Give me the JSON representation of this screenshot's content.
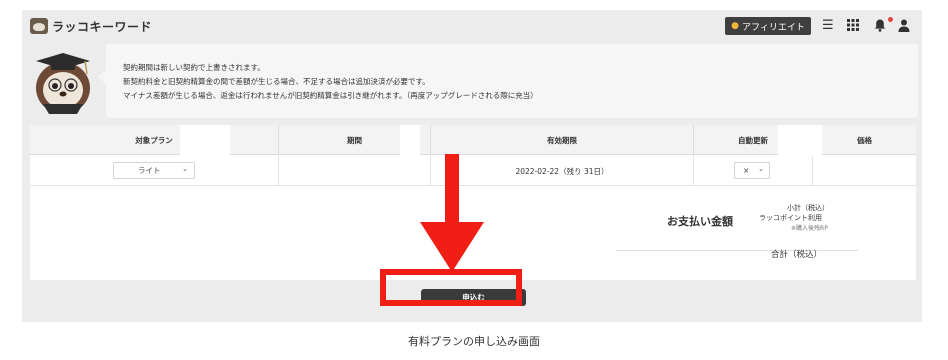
{
  "header": {
    "app_name": "ラッコキーワード",
    "affiliate_label": "アフィリエイト",
    "icons": [
      "coin-icon",
      "menu-icon",
      "grid-icon",
      "bell-icon",
      "user-icon"
    ]
  },
  "notice": {
    "lines": [
      "契約期間は新しい契約で上書きされます。",
      "新契約料金と旧契約精算金の間で差額が生じる場合、不足する場合は追加決済が必要です。",
      "マイナス差額が生じる場合、返金は行われませんが旧契約精算金は引き継がれます。（再度アップグレードされる際に充当）"
    ]
  },
  "table": {
    "headers": [
      "対象プラン",
      "期間",
      "有効期限",
      "自動更新",
      "価格"
    ],
    "row": {
      "plan": "ライト",
      "period": "",
      "expiry": "2022-02-22（残り 31日）",
      "auto_renew": "×",
      "price": ""
    }
  },
  "payment": {
    "title": "お支払い金額",
    "subtotal_label": "小計（税込）",
    "points_label": "ラッコポイント利用",
    "points_note": "※購入後残RP",
    "total_label": "合計（税込）"
  },
  "apply_button": "申込む",
  "caption": "有料プランの申し込み画面",
  "colors": {
    "annotation_red": "#f01e14",
    "button_dark": "#3a3a3a",
    "coin_gold": "#f3b83b",
    "notification_dot": "#e0463a"
  }
}
